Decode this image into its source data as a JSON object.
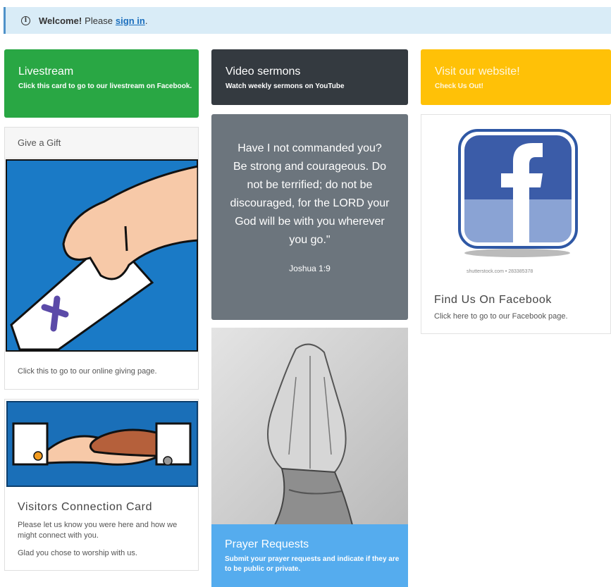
{
  "alert": {
    "icon": "info-icon",
    "welcome": "Welcome!",
    "text": "Please",
    "link": "sign in",
    "suffix": "."
  },
  "cards": {
    "livestream": {
      "title": "Livestream",
      "subtitle": "Click this card to go to our livestream on Facebook.",
      "color": "#29a744"
    },
    "video": {
      "title": "Video sermons",
      "subtitle": "Watch weekly sermons on YouTube",
      "color": "#343a40"
    },
    "website": {
      "title": "Visit our website!",
      "subtitle": "Check Us Out!",
      "color": "#ffc107"
    },
    "gift": {
      "header": "Give a Gift",
      "text": "Click this to go to our online giving page."
    },
    "quote": {
      "text": "Have I not commanded you? Be strong and courageous. Do not be terrified; do not be discouraged, for the LORD your God will be with you wherever you go.\"",
      "reference": "Joshua 1:9",
      "color": "#6c757d"
    },
    "facebook": {
      "watermark": "shutterstock.com • 283385378",
      "title": "Find Us On Facebook",
      "text": "Click here to go to our Facebook page."
    },
    "visitors": {
      "title": "Visitors Connection Card",
      "text": "Please let us know you were here and how we might connect with you.",
      "text2": "Glad you chose to worship with us."
    },
    "prayer": {
      "title": "Prayer Requests",
      "subtitle": "Submit your prayer requests and indicate if they are to be public or private.",
      "color": "#55acee"
    }
  }
}
